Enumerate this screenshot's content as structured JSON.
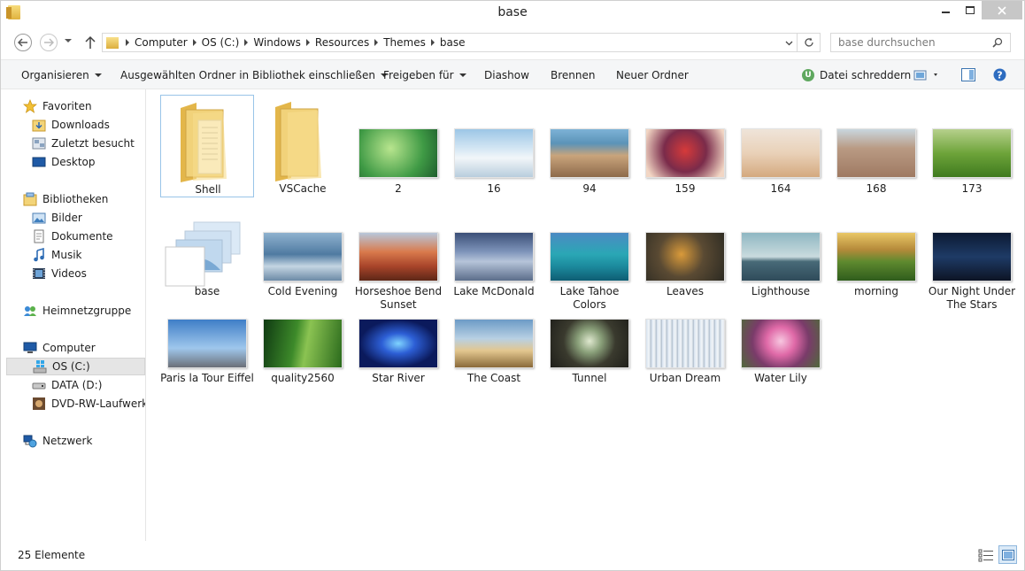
{
  "window": {
    "title": "base"
  },
  "address": {
    "crumbs": [
      "Computer",
      "OS (C:)",
      "Windows",
      "Resources",
      "Themes",
      "base"
    ]
  },
  "search": {
    "placeholder": "base durchsuchen"
  },
  "toolbar": {
    "organize": "Organisieren",
    "include_library": "Ausgewählten Ordner in Bibliothek einschließen",
    "share": "Freigeben für",
    "slideshow": "Diashow",
    "burn": "Brennen",
    "new_folder": "Neuer Ordner",
    "shred": "Datei schreddern"
  },
  "sidebar": {
    "favorites": "Favoriten",
    "downloads": "Downloads",
    "recent": "Zuletzt besucht",
    "desktop": "Desktop",
    "libraries": "Bibliotheken",
    "pictures": "Bilder",
    "documents": "Dokumente",
    "music": "Musik",
    "videos": "Videos",
    "homegroup": "Heimnetzgruppe",
    "computer": "Computer",
    "os": "OS (C:)",
    "data": "DATA (D:)",
    "dvd": "DVD-RW-Laufwerk (",
    "network": "Netzwerk"
  },
  "items": [
    {
      "name": "Shell"
    },
    {
      "name": "VSCache"
    },
    {
      "name": "2"
    },
    {
      "name": "16"
    },
    {
      "name": "94"
    },
    {
      "name": "159"
    },
    {
      "name": "164"
    },
    {
      "name": "168"
    },
    {
      "name": "173"
    },
    {
      "name": "base"
    },
    {
      "name": "Cold Evening"
    },
    {
      "name": "Horseshoe Bend Sunset"
    },
    {
      "name": "Lake McDonald"
    },
    {
      "name": "Lake Tahoe Colors"
    },
    {
      "name": "Leaves"
    },
    {
      "name": "Lighthouse"
    },
    {
      "name": "morning"
    },
    {
      "name": "Our Night Under The Stars"
    },
    {
      "name": "Paris la Tour Eiffel"
    },
    {
      "name": "quality2560"
    },
    {
      "name": "Star River"
    },
    {
      "name": "The Coast"
    },
    {
      "name": "Tunnel"
    },
    {
      "name": "Urban Dream"
    },
    {
      "name": "Water Lily"
    }
  ],
  "status": {
    "count": "25 Elemente"
  }
}
